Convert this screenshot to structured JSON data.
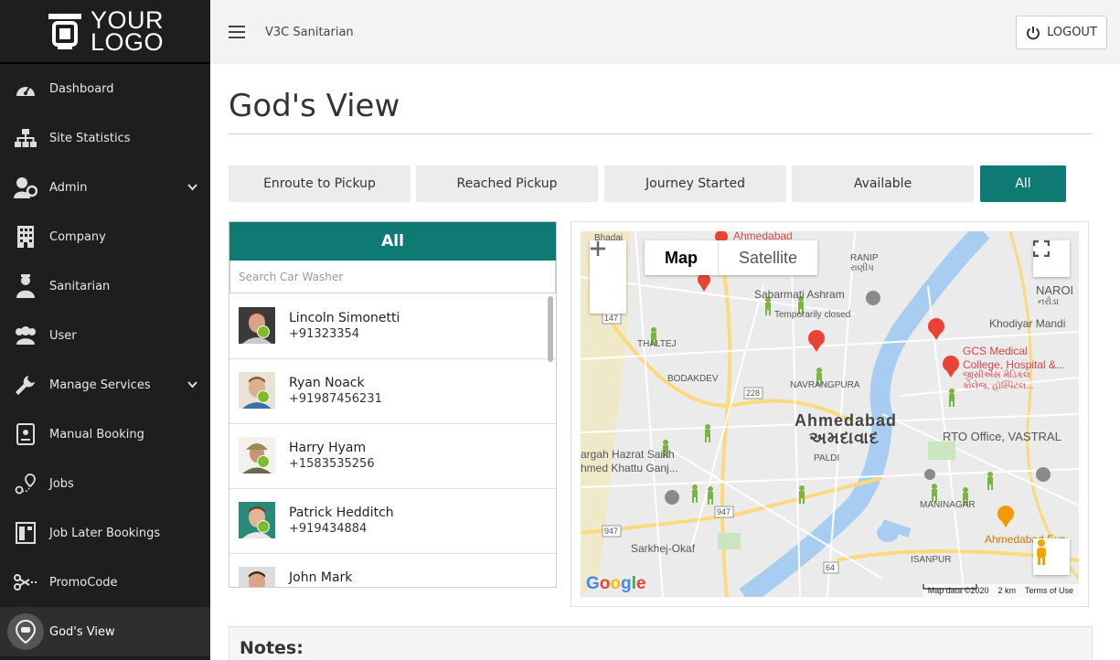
{
  "logo": {
    "line1": "YOUR",
    "line2": "LOGO"
  },
  "sidebar": {
    "items": [
      {
        "label": "Dashboard"
      },
      {
        "label": "Site Statistics"
      },
      {
        "label": "Admin"
      },
      {
        "label": "Company"
      },
      {
        "label": "Sanitarian"
      },
      {
        "label": "User"
      },
      {
        "label": "Manage Services"
      },
      {
        "label": "Manual Booking"
      },
      {
        "label": "Jobs"
      },
      {
        "label": "Job Later Bookings"
      },
      {
        "label": "PromoCode"
      },
      {
        "label": "God's View"
      }
    ]
  },
  "topbar": {
    "site_name": "V3C Sanitarian",
    "logout_label": "LOGOUT"
  },
  "page": {
    "title": "God's View"
  },
  "filters": [
    "Enroute to Pickup",
    "Reached Pickup",
    "Journey Started",
    "Available",
    "All"
  ],
  "list": {
    "header": "All",
    "search_placeholder": "Search Car Washer",
    "people": [
      {
        "name": "Lincoln Simonetti",
        "phone": "+91323354"
      },
      {
        "name": "Ryan Noack",
        "phone": "+91987456231"
      },
      {
        "name": "Harry Hyam",
        "phone": "+1583535256"
      },
      {
        "name": "Patrick Hedditch",
        "phone": "+919434884"
      },
      {
        "name": "John Mark",
        "phone": ""
      }
    ]
  },
  "map": {
    "type_map": "Map",
    "type_satellite": "Satellite",
    "city_en": "Ahmedabad",
    "city_gu": "અમદાવાદ",
    "labels": {
      "bhadaj": "Bhadaj",
      "ahmedabad_top": "Ahmedabad",
      "ranip": "RANIP",
      "ranip_gu": "રાણીપ",
      "naroda": "NAROI",
      "naroda_gu": "નરોડા",
      "sabarmati": "Sabarmati Ashram",
      "sabarmati_closed": "Temporarily closed",
      "khodiyar": "Khodiyar Mandi",
      "gcs1": "GCS Medical",
      "gcs2": "College, Hospital &...",
      "gcs3": "જીસીએસ મેડિકલ",
      "gcs4": "કોલેજ, હૉસ્પિટલ...",
      "thaltej": "THALTEJ",
      "bodakdev": "BODAKDEV",
      "navrangpura": "NAVRANGPURA",
      "rto": "RTO Office, VASTRAL",
      "dargah1": "argah Hazrat Saikh",
      "dargah2": "hmed Khattu Ganj...",
      "paldi": "PALDI",
      "maninagar": "MANINAGAR",
      "sarkhej": "Sarkhej-Okaf",
      "isanpur": "ISANPUR",
      "ahmedabad_exp": "Ahmedabad Exp",
      "road_147": "147",
      "road_228": "228",
      "road_947a": "947",
      "road_947b": "947",
      "road_64": "64"
    },
    "footer_data": "Map data ©2020",
    "footer_scale": "2 km",
    "footer_terms": "Terms of Use",
    "google": "Google"
  },
  "notes": {
    "title": "Notes:"
  }
}
